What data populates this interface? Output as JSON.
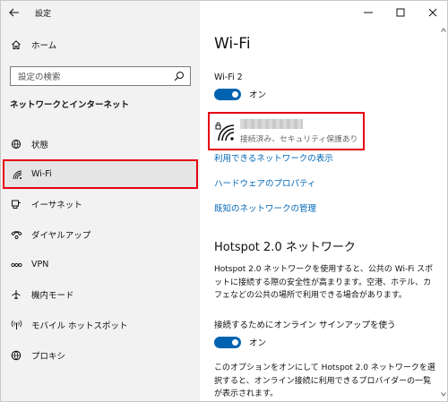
{
  "window": {
    "app_title": "設定",
    "controls": {
      "minimize": "—",
      "maximize": "☐",
      "close": "✕"
    }
  },
  "sidebar": {
    "home_label": "ホーム",
    "search_placeholder": "設定の検索",
    "section_title": "ネットワークとインターネット",
    "items": [
      {
        "label": "状態",
        "icon": "globe-status-icon"
      },
      {
        "label": "Wi-Fi",
        "icon": "wifi-icon",
        "selected": true
      },
      {
        "label": "イーサネット",
        "icon": "ethernet-icon"
      },
      {
        "label": "ダイヤルアップ",
        "icon": "dialup-icon"
      },
      {
        "label": "VPN",
        "icon": "vpn-icon"
      },
      {
        "label": "機内モード",
        "icon": "airplane-icon"
      },
      {
        "label": "モバイル ホットスポット",
        "icon": "hotspot-icon"
      },
      {
        "label": "プロキシ",
        "icon": "globe-icon"
      }
    ]
  },
  "main": {
    "title": "Wi-Fi",
    "wifi_label": "Wi-Fi 2",
    "wifi_toggle": "オン",
    "network": {
      "name": "",
      "status": "接続済み、セキュリティ保護あり"
    },
    "links": {
      "available": "利用できるネットワークの表示",
      "hardware": "ハードウェアのプロパティ",
      "known": "既知のネットワークの管理"
    },
    "hotspot": {
      "heading": "Hotspot 2.0 ネットワーク",
      "description": "Hotspot 2.0 ネットワークを使用すると、公共の Wi-Fi スポットに接続する際の安全性が高まります。空港、ホテル、カフェなどの公共の場所で利用できる場合があります。",
      "signup_label": "接続するためにオンライン サインアップを使う",
      "signup_toggle": "オン",
      "option_description": "このオプションをオンにして Hotspot 2.0 ネットワークを選択すると、オンライン接続に利用できるプロバイダーの一覧が表示されます。"
    }
  },
  "colors": {
    "accent": "#0063b1",
    "link": "#0067b8",
    "highlight_border": "#e60012",
    "sidebar_bg": "#f2f2f2"
  }
}
